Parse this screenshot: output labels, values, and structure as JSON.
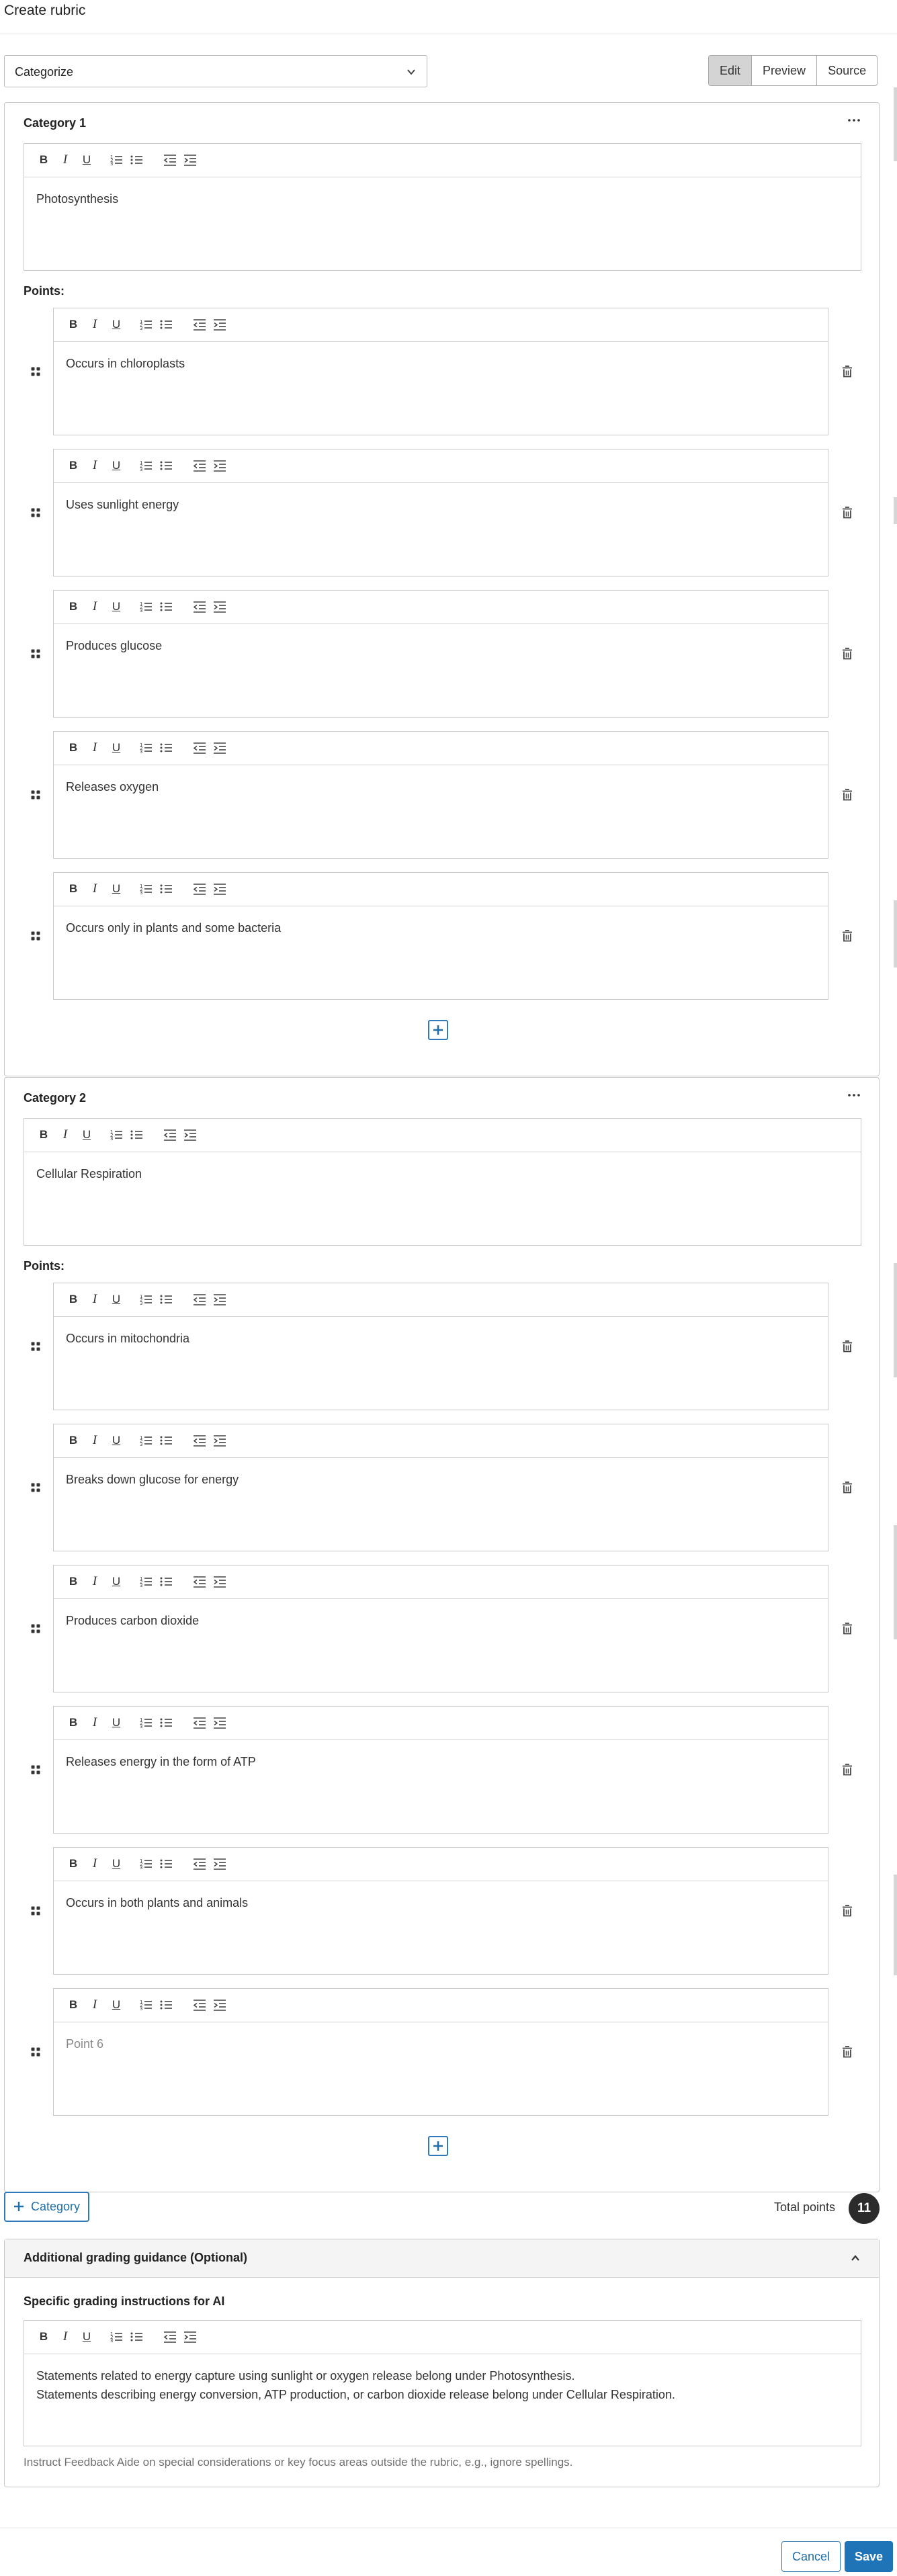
{
  "page": {
    "title": "Create rubric"
  },
  "rubric_type": {
    "selected": "Categorize"
  },
  "view_modes": [
    {
      "label": "Edit",
      "active": true
    },
    {
      "label": "Preview",
      "active": false
    },
    {
      "label": "Source",
      "active": false
    }
  ],
  "categories": [
    {
      "title": "Category 1",
      "description": "Photosynthesis",
      "points_label": "Points:",
      "points": [
        {
          "text": "Occurs in chloroplasts",
          "placeholder": false
        },
        {
          "text": "Uses sunlight energy",
          "placeholder": false
        },
        {
          "text": "Produces glucose",
          "placeholder": false
        },
        {
          "text": "Releases oxygen",
          "placeholder": false
        },
        {
          "text": "Occurs only in plants and some bacteria",
          "placeholder": false
        }
      ]
    },
    {
      "title": "Category 2",
      "description": "Cellular Respiration",
      "points_label": "Points:",
      "points": [
        {
          "text": "Occurs in mitochondria",
          "placeholder": false
        },
        {
          "text": "Breaks down glucose for energy",
          "placeholder": false
        },
        {
          "text": "Produces carbon dioxide",
          "placeholder": false
        },
        {
          "text": "Releases energy in the form of ATP",
          "placeholder": false
        },
        {
          "text": "Occurs in both plants and animals",
          "placeholder": false
        },
        {
          "text": "Point 6",
          "placeholder": true
        }
      ]
    }
  ],
  "toolbar_buttons": {
    "bold": "B",
    "italic": "I",
    "underline": "U"
  },
  "actions": {
    "add_category": "Category",
    "total_points_label": "Total points",
    "total_points_value": "11"
  },
  "guidance": {
    "header": "Additional grading guidance (Optional)",
    "subheading": "Specific grading instructions for AI",
    "lines": [
      "Statements related to energy capture using sunlight or oxygen release belong under Photosynthesis.",
      "Statements describing energy conversion, ATP production, or carbon dioxide release belong under Cellular Respiration."
    ],
    "help_text": "Instruct Feedback Aide on special considerations or key focus areas outside the rubric, e.g., ignore spellings."
  },
  "footer": {
    "cancel": "Cancel",
    "save": "Save"
  },
  "colors": {
    "accent": "#1f73b7",
    "badge": "#2b2b2b",
    "active_mode": "#d4d4d4"
  }
}
